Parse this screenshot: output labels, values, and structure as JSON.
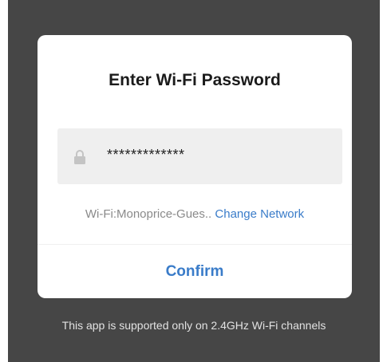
{
  "dialog": {
    "title": "Enter Wi-Fi Password",
    "password_masked": "*************",
    "network_label": "Wi-Fi:Monoprice-Gues..",
    "change_network_label": "Change Network",
    "confirm_label": "Confirm"
  },
  "footer": {
    "note": "This app is supported only on 2.4GHz Wi-Fi channels"
  },
  "icons": {
    "password_field": "lock-icon"
  },
  "colors": {
    "overlay": "#464646",
    "accent": "#3a7cc9",
    "field_background": "#efefef"
  }
}
